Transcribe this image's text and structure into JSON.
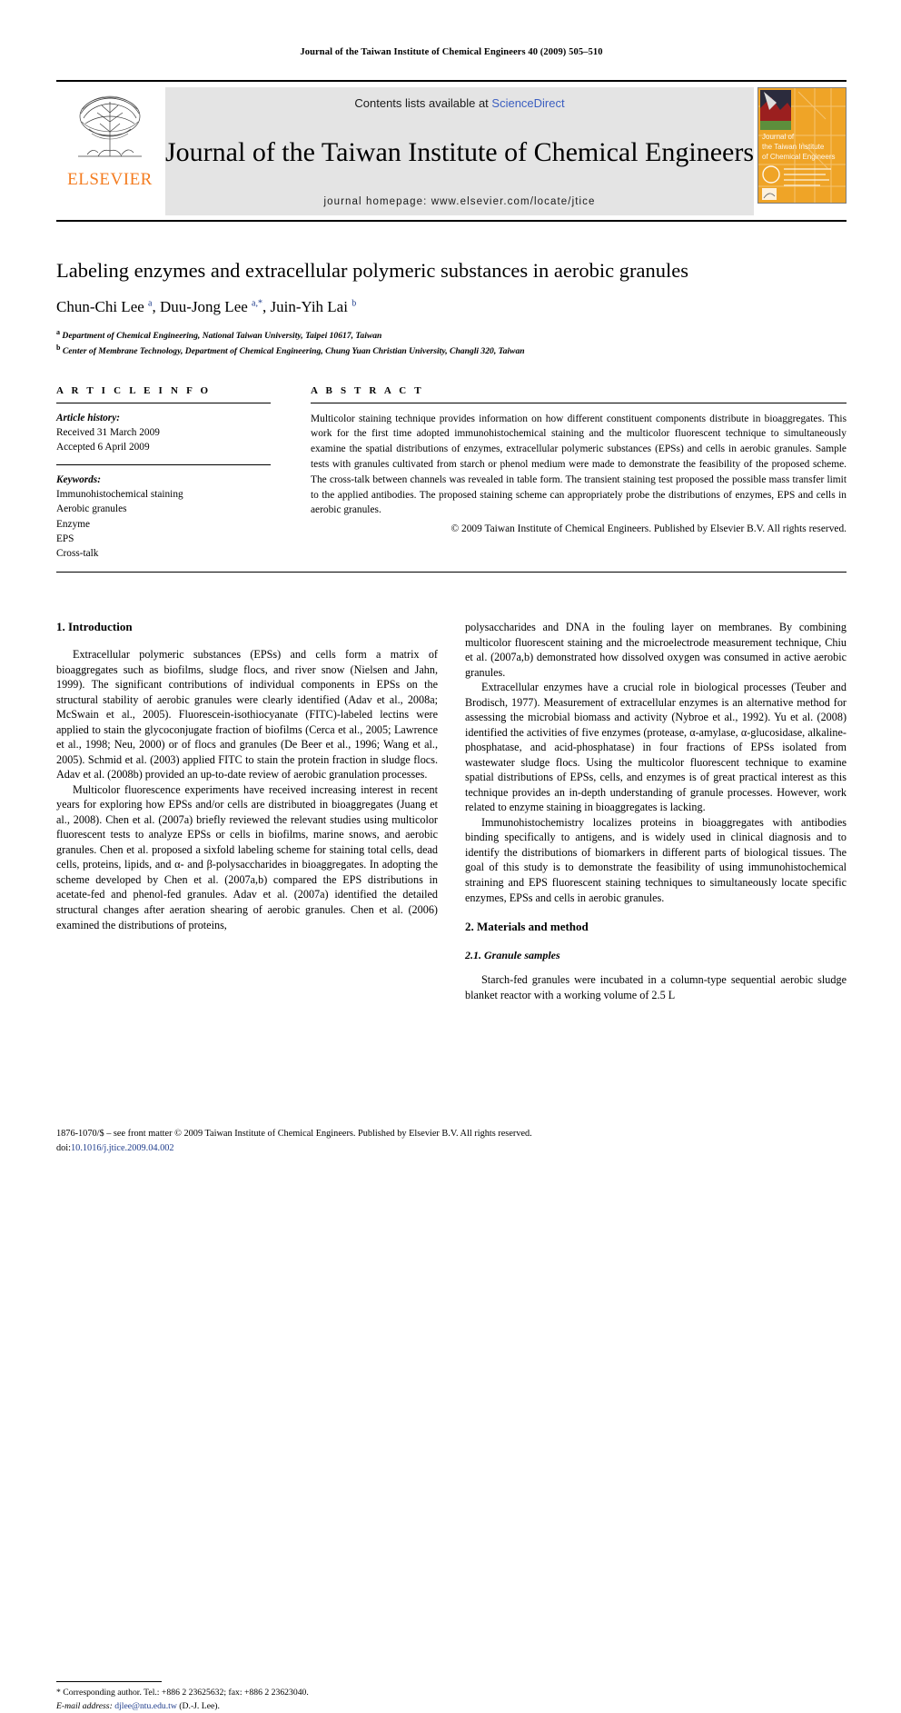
{
  "running_head": "Journal of the Taiwan Institute of Chemical Engineers 40 (2009) 505–510",
  "masthead": {
    "publisher_name": "ELSEVIER",
    "contents_prefix": "Contents lists available at ",
    "contents_link": "ScienceDirect",
    "journal_name": "Journal of the Taiwan Institute of Chemical Engineers",
    "homepage": "journal homepage: www.elsevier.com/locate/jtice",
    "cover_lines": [
      "Journal of",
      "the Taiwan Institute",
      "of Chemical Engineers"
    ],
    "link_color": "#3b5ec0",
    "elsevier_orange": "#F47C20",
    "banner_bg": "#e4e4e4"
  },
  "article": {
    "title": "Labeling enzymes and extracellular polymeric substances in aerobic granules",
    "authors": "Chun-Chi Lee a, Duu-Jong Lee a,*, Juin-Yih Lai b",
    "affiliation_a": "Department of Chemical Engineering, National Taiwan University, Taipei 10617, Taiwan",
    "affiliation_b": "Center of Membrane Technology, Department of Chemical Engineering, Chung Yuan Christian University, Changli 320, Taiwan"
  },
  "article_info": {
    "heading": "A R T I C L E  I N F O",
    "history_label": "Article history:",
    "received": "Received 31 March 2009",
    "accepted": "Accepted 6 April 2009",
    "keywords_label": "Keywords:",
    "keywords": [
      "Immunohistochemical staining",
      "Aerobic granules",
      "Enzyme",
      "EPS",
      "Cross-talk"
    ]
  },
  "abstract": {
    "heading": "A B S T R A C T",
    "text": "Multicolor staining technique provides information on how different constituent components distribute in bioaggregates. This work for the first time adopted immunohistochemical staining and the multicolor fluorescent technique to simultaneously examine the spatial distributions of enzymes, extracellular polymeric substances (EPSs) and cells in aerobic granules. Sample tests with granules cultivated from starch or phenol medium were made to demonstrate the feasibility of the proposed scheme. The cross-talk between channels was revealed in table form. The transient staining test proposed the possible mass transfer limit to the applied antibodies. The proposed staining scheme can appropriately probe the distributions of enzymes, EPS and cells in aerobic granules.",
    "copyright": "© 2009 Taiwan Institute of Chemical Engineers. Published by Elsevier B.V. All rights reserved."
  },
  "sections": {
    "introduction_heading": "1. Introduction",
    "materials_heading": "2. Materials and method",
    "granule_subheading": "2.1. Granule samples"
  },
  "body": {
    "left": [
      "Extracellular polymeric substances (EPSs) and cells form a matrix of bioaggregates such as biofilms, sludge flocs, and river snow (Nielsen and Jahn, 1999). The significant contributions of individual components in EPSs on the structural stability of aerobic granules were clearly identified (Adav et al., 2008a; McSwain et al., 2005). Fluorescein-isothiocyanate (FITC)-labeled lectins were applied to stain the glycoconjugate fraction of biofilms (Cerca et al., 2005; Lawrence et al., 1998; Neu, 2000) or of flocs and granules (De Beer et al., 1996; Wang et al., 2005). Schmid et al. (2003) applied FITC to stain the protein fraction in sludge flocs. Adav et al. (2008b) provided an up-to-date review of aerobic granulation processes.",
      "Multicolor fluorescence experiments have received increasing interest in recent years for exploring how EPSs and/or cells are distributed in bioaggregates (Juang et al., 2008). Chen et al. (2007a) briefly reviewed the relevant studies using multicolor fluorescent tests to analyze EPSs or cells in biofilms, marine snows, and aerobic granules. Chen et al. proposed a sixfold labeling scheme for staining total cells, dead cells, proteins, lipids, and α- and β-polysaccharides in bioaggregates. In adopting the scheme developed by Chen et al. (2007a,b) compared the EPS distributions in acetate-fed and phenol-fed granules. Adav et al. (2007a) identified the detailed structural changes after aeration shearing of aerobic granules. Chen et al. (2006) examined the distributions of proteins,"
    ],
    "right": [
      "polysaccharides and DNA in the fouling layer on membranes. By combining multicolor fluorescent staining and the microelectrode measurement technique, Chiu et al. (2007a,b) demonstrated how dissolved oxygen was consumed in active aerobic granules.",
      "Extracellular enzymes have a crucial role in biological processes (Teuber and Brodisch, 1977). Measurement of extracellular enzymes is an alternative method for assessing the microbial biomass and activity (Nybroe et al., 1992). Yu et al. (2008) identified the activities of five enzymes (protease, α-amylase, α-glucosidase, alkaline-phosphatase, and acid-phosphatase) in four fractions of EPSs isolated from wastewater sludge flocs. Using the multicolor fluorescent technique to examine spatial distributions of EPSs, cells, and enzymes is of great practical interest as this technique provides an in-depth understanding of granule processes. However, work related to enzyme staining in bioaggregates is lacking.",
      "Immunohistochemistry localizes proteins in bioaggregates with antibodies binding specifically to antigens, and is widely used in clinical diagnosis and to identify the distributions of biomarkers in different parts of biological tissues. The goal of this study is to demonstrate the feasibility of using immunohistochemical straining and EPS fluorescent staining techniques to simultaneously locate specific enzymes, EPSs and cells in aerobic granules.",
      "Starch-fed granules were incubated in a column-type sequential aerobic sludge blanket reactor with a working volume of 2.5 L"
    ]
  },
  "footnote": {
    "corresponding": "* Corresponding author. Tel.: +886 2 23625632; fax: +886 2 23623040.",
    "email_label": "E-mail address:",
    "email": "djlee@ntu.edu.tw",
    "email_suffix": "(D.-J. Lee)."
  },
  "page_footer": {
    "issn_line": "1876-1070/$ – see front matter © 2009 Taiwan Institute of Chemical Engineers. Published by Elsevier B.V. All rights reserved.",
    "doi_label": "doi:",
    "doi": "10.1016/j.jtice.2009.04.002"
  }
}
